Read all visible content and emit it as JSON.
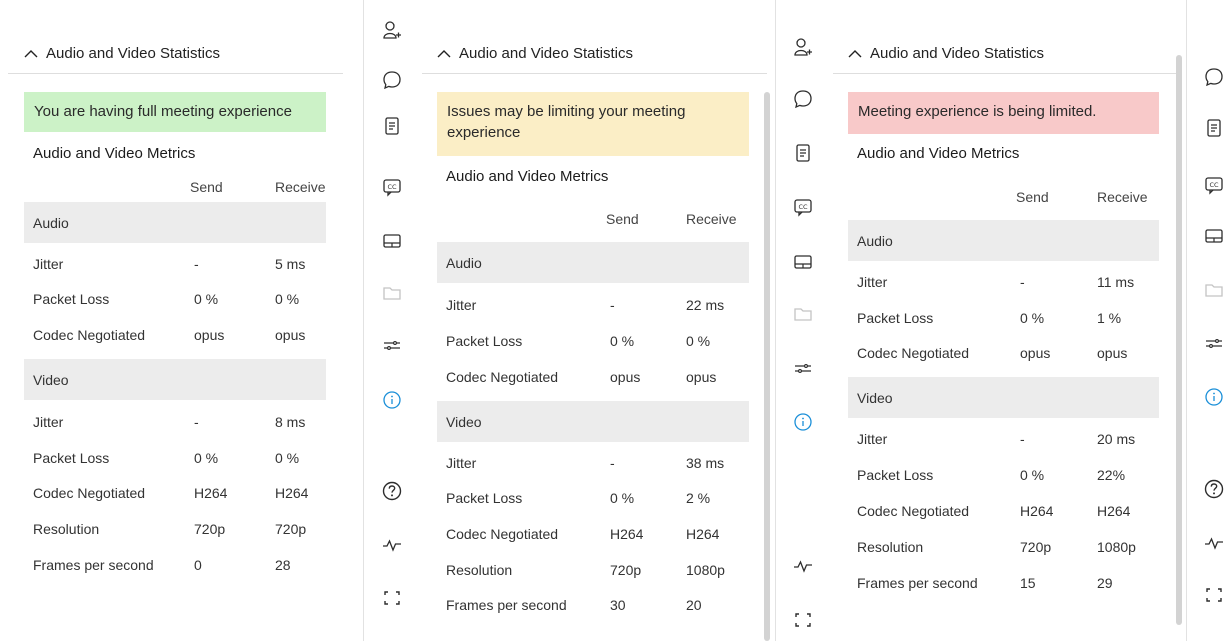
{
  "panel1": {
    "header": "Audio and Video Statistics",
    "banner": "You are having full meeting experience",
    "banner_color": "#ccf2c7",
    "metrics_title": "Audio and Video Metrics",
    "col_send": "Send",
    "col_receive": "Receive",
    "audio_label": "Audio",
    "video_label": "Video",
    "audio_rows": [
      {
        "label": "Jitter",
        "send": "-",
        "receive": "5 ms"
      },
      {
        "label": "Packet Loss",
        "send": "0 %",
        "receive": "0 %"
      },
      {
        "label": "Codec Negotiated",
        "send": "opus",
        "receive": "opus"
      }
    ],
    "video_rows": [
      {
        "label": "Jitter",
        "send": "-",
        "receive": "8 ms"
      },
      {
        "label": "Packet Loss",
        "send": "0 %",
        "receive": "0 %"
      },
      {
        "label": "Codec Negotiated",
        "send": "H264",
        "receive": "H264"
      },
      {
        "label": "Resolution",
        "send": "720p",
        "receive": "720p"
      },
      {
        "label": "Frames per second",
        "send": "0",
        "receive": "28"
      }
    ]
  },
  "panel2": {
    "header": "Audio and Video Statistics",
    "banner": "Issues may be limiting your meeting experience",
    "banner_color": "#fbeec6",
    "metrics_title": "Audio and Video Metrics",
    "col_send": "Send",
    "col_receive": "Receive",
    "audio_label": "Audio",
    "video_label": "Video",
    "audio_rows": [
      {
        "label": "Jitter",
        "send": "-",
        "receive": "22 ms"
      },
      {
        "label": "Packet Loss",
        "send": "0 %",
        "receive": "0 %"
      },
      {
        "label": "Codec Negotiated",
        "send": "opus",
        "receive": "opus"
      }
    ],
    "video_rows": [
      {
        "label": "Jitter",
        "send": "-",
        "receive": "38 ms"
      },
      {
        "label": "Packet Loss",
        "send": "0 %",
        "receive": "2 %"
      },
      {
        "label": "Codec Negotiated",
        "send": "H264",
        "receive": "H264"
      },
      {
        "label": "Resolution",
        "send": "720p",
        "receive": "1080p"
      },
      {
        "label": "Frames per second",
        "send": "30",
        "receive": "20"
      }
    ]
  },
  "panel3": {
    "header": "Audio and Video Statistics",
    "banner": "Meeting experience is being limited.",
    "banner_color": "#f8c9c9",
    "metrics_title": "Audio and Video Metrics",
    "col_send": "Send",
    "col_receive": "Receive",
    "audio_label": "Audio",
    "video_label": "Video",
    "audio_rows": [
      {
        "label": "Jitter",
        "send": "-",
        "receive": "11 ms"
      },
      {
        "label": "Packet Loss",
        "send": "0 %",
        "receive": "1 %"
      },
      {
        "label": "Codec Negotiated",
        "send": "opus",
        "receive": "opus"
      }
    ],
    "video_rows": [
      {
        "label": "Jitter",
        "send": "-",
        "receive": "20 ms"
      },
      {
        "label": "Packet Loss",
        "send": "0 %",
        "receive": "22%"
      },
      {
        "label": "Codec Negotiated",
        "send": "H264",
        "receive": "H264"
      },
      {
        "label": "Resolution",
        "send": "720p",
        "receive": "1080p"
      },
      {
        "label": "Frames per second",
        "send": "15",
        "receive": "29"
      }
    ]
  },
  "toolbars": {
    "bar1": [
      "participants-icon",
      "chat-icon",
      "notes-icon",
      "captions-icon",
      "layout-icon",
      "folder-icon",
      "settings-sliders-icon",
      "info-icon",
      "help-icon",
      "activity-icon",
      "fullscreen-icon"
    ],
    "bar2": [
      "participants-icon",
      "chat-icon",
      "notes-icon",
      "captions-icon",
      "layout-icon",
      "folder-icon",
      "settings-sliders-icon",
      "info-icon",
      "activity-icon",
      "fullscreen-icon"
    ],
    "bar3": [
      "chat-icon",
      "notes-icon",
      "captions-icon",
      "layout-icon",
      "folder-icon",
      "settings-sliders-icon",
      "info-icon",
      "help-icon",
      "activity-icon",
      "fullscreen-icon"
    ]
  },
  "colors": {
    "section_bg": "#ececec",
    "accent_info": "#1a8fd8",
    "divider": "#e2e2e2"
  }
}
